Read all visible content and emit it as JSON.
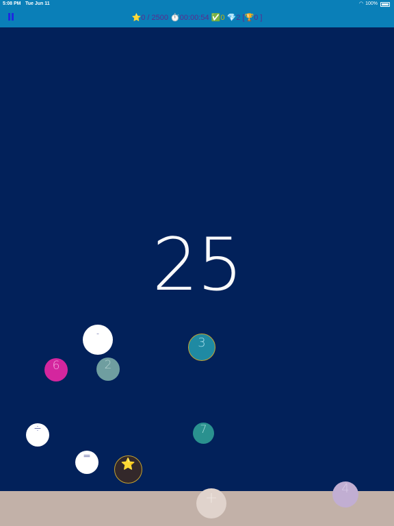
{
  "status_bar": {
    "time": "5:08 PM",
    "date": "Tue Jun 11",
    "battery": "100%"
  },
  "hud": {
    "stars_icon": "⭐",
    "stars": "0 / 2500",
    "timer_icon": "⏱️",
    "timer": "00:00:54",
    "check_icon": "✅",
    "check_count": "0",
    "gem_icon": "💎",
    "gem_count": "2",
    "trophy_open": "[",
    "trophy_icon": "🏆",
    "trophy_count": "0",
    "trophy_close": "]"
  },
  "target_number": "25",
  "balls": [
    {
      "label": "-",
      "kind": "operator-minus",
      "color": "#ffffff",
      "text_color": "#1a237e"
    },
    {
      "label": "6",
      "kind": "number",
      "color": "#d4269e",
      "text_color": "#f3a8df"
    },
    {
      "label": "2",
      "kind": "number",
      "color": "#6f9ea0",
      "text_color": "#b7d4d2"
    },
    {
      "label": "3",
      "kind": "number",
      "color": "#1f8aa3",
      "text_color": "#a2dce8",
      "border": "#c7a32d"
    },
    {
      "label": "÷",
      "kind": "operator-divide",
      "color": "#ffffff",
      "text_color": "#1a237e"
    },
    {
      "label": "7",
      "kind": "number",
      "color": "#2a918f",
      "text_color": "#a7e1dc"
    },
    {
      "label": "=",
      "kind": "operator-equals",
      "color": "#ffffff",
      "text_color": "#1a237e"
    },
    {
      "label": "⭐",
      "kind": "star",
      "color": "#33282a",
      "text_color": "#ffcc00",
      "border": "#c7a32d"
    },
    {
      "label": "+",
      "kind": "operator-plus",
      "color": "#e0d3cc",
      "text_color": "#eee6e1"
    },
    {
      "label": "4",
      "kind": "number",
      "color": "#c1aed2",
      "text_color": "#d9cbe6"
    }
  ],
  "colors": {
    "background": "#02215a",
    "top_bar": "#0a7fb8",
    "floor": "#c2b1a8"
  }
}
